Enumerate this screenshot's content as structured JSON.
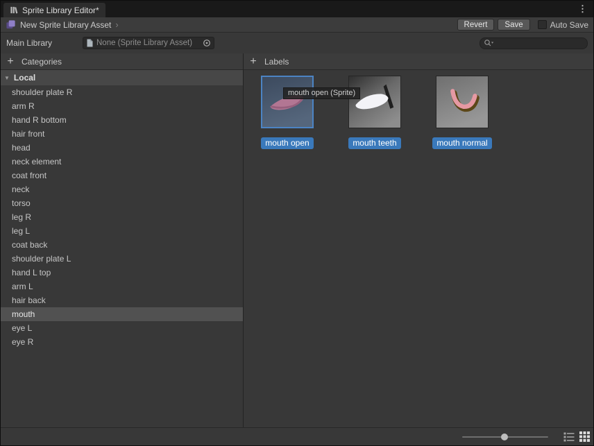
{
  "window": {
    "tab_title": "Sprite Library Editor*",
    "kebab_icon": "⋮"
  },
  "toolbar": {
    "asset_breadcrumb": "New Sprite Library Asset",
    "breadcrumb_icon": "›",
    "revert_label": "Revert",
    "save_label": "Save",
    "auto_save_label": "Auto Save",
    "auto_save_checked": false
  },
  "library_row": {
    "label": "Main Library",
    "object_value": "None (Sprite Library Asset)",
    "search_value": ""
  },
  "categories_panel": {
    "add_icon": "+",
    "header": "Categories",
    "foldout_icon": "▼",
    "group_label": "Local",
    "items": [
      "shoulder plate R",
      "arm R",
      "hand R bottom",
      "hair front",
      "head",
      "neck element",
      "coat front",
      "neck",
      "torso",
      "leg R",
      "leg L",
      "coat back",
      "shoulder plate L",
      "hand L top",
      "arm L",
      "hair back",
      "mouth",
      "eye L",
      "eye R"
    ],
    "selected_item": "mouth"
  },
  "labels_panel": {
    "add_icon": "+",
    "header": "Labels",
    "tooltip": "mouth open (Sprite)",
    "items": [
      {
        "name": "mouth open",
        "icon": "mouth-open-sprite",
        "selected": true
      },
      {
        "name": "mouth teeth",
        "icon": "mouth-teeth-sprite",
        "selected": false
      },
      {
        "name": "mouth normal",
        "icon": "mouth-normal-sprite",
        "selected": false
      }
    ]
  },
  "bottom_bar": {
    "zoom_slider_value": 0.49
  },
  "colors": {
    "selection_blue": "#3a79bb",
    "row_selected": "#515151"
  }
}
